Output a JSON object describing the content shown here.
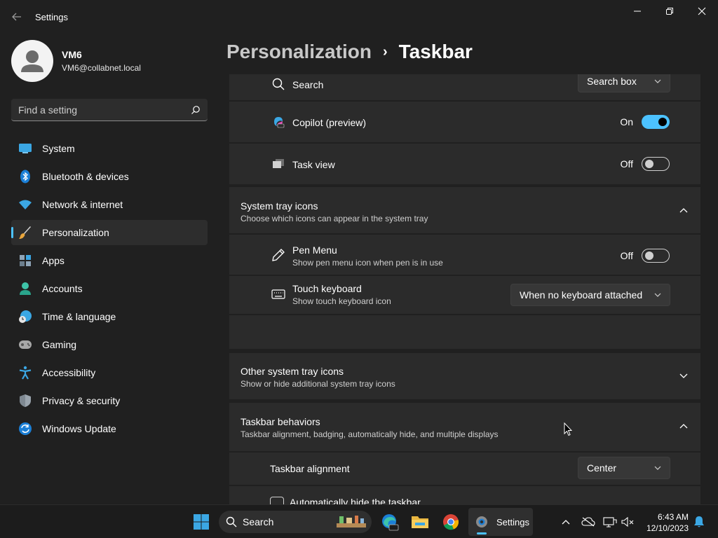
{
  "window": {
    "app_title": "Settings",
    "controls": [
      "minimize",
      "restore",
      "close"
    ]
  },
  "profile": {
    "name": "VM6",
    "email": "VM6@collabnet.local"
  },
  "search": {
    "placeholder": "Find a setting"
  },
  "sidebar": {
    "items": [
      {
        "label": "System",
        "icon": "system-icon",
        "active": false
      },
      {
        "label": "Bluetooth & devices",
        "icon": "bluetooth-icon",
        "active": false
      },
      {
        "label": "Network & internet",
        "icon": "wifi-icon",
        "active": false
      },
      {
        "label": "Personalization",
        "icon": "brush-icon",
        "active": true
      },
      {
        "label": "Apps",
        "icon": "apps-icon",
        "active": false
      },
      {
        "label": "Accounts",
        "icon": "accounts-icon",
        "active": false
      },
      {
        "label": "Time & language",
        "icon": "globe-clock-icon",
        "active": false
      },
      {
        "label": "Gaming",
        "icon": "gamepad-icon",
        "active": false
      },
      {
        "label": "Accessibility",
        "icon": "accessibility-icon",
        "active": false
      },
      {
        "label": "Privacy & security",
        "icon": "shield-icon",
        "active": false
      },
      {
        "label": "Windows Update",
        "icon": "update-icon",
        "active": false
      }
    ]
  },
  "breadcrumb": {
    "parent": "Personalization",
    "separator": "›",
    "current": "Taskbar"
  },
  "taskbar_items": {
    "search": {
      "label": "Search",
      "value": "Search box"
    },
    "copilot": {
      "label": "Copilot (preview)",
      "state": "On"
    },
    "task_view": {
      "label": "Task view",
      "state": "Off"
    }
  },
  "system_tray": {
    "title": "System tray icons",
    "subtitle": "Choose which icons can appear in the system tray",
    "pen_menu": {
      "label": "Pen Menu",
      "sub": "Show pen menu icon when pen is in use",
      "state": "Off"
    },
    "touch_keyboard": {
      "label": "Touch keyboard",
      "sub": "Show touch keyboard icon",
      "value": "When no keyboard attached"
    }
  },
  "other_tray": {
    "title": "Other system tray icons",
    "subtitle": "Show or hide additional system tray icons"
  },
  "behaviors": {
    "title": "Taskbar behaviors",
    "subtitle": "Taskbar alignment, badging, automatically hide, and multiple displays",
    "alignment": {
      "label": "Taskbar alignment",
      "value": "Center"
    },
    "autohide": {
      "label": "Automatically hide the taskbar",
      "checked": false
    }
  },
  "taskbar": {
    "search_label": "Search",
    "settings_label": "Settings",
    "time": "6:43 AM",
    "date": "12/10/2023"
  },
  "colors": {
    "accent": "#4cc2ff",
    "background": "#202020",
    "card": "#2b2b2b"
  }
}
